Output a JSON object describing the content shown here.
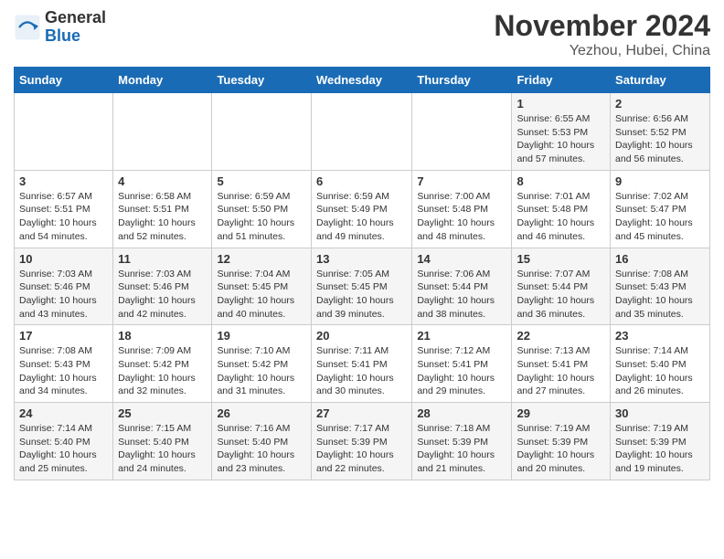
{
  "header": {
    "logo_line1": "General",
    "logo_line2": "Blue",
    "title": "November 2024",
    "subtitle": "Yezhou, Hubei, China"
  },
  "weekdays": [
    "Sunday",
    "Monday",
    "Tuesday",
    "Wednesday",
    "Thursday",
    "Friday",
    "Saturday"
  ],
  "weeks": [
    [
      {
        "day": "",
        "info": ""
      },
      {
        "day": "",
        "info": ""
      },
      {
        "day": "",
        "info": ""
      },
      {
        "day": "",
        "info": ""
      },
      {
        "day": "",
        "info": ""
      },
      {
        "day": "1",
        "info": "Sunrise: 6:55 AM\nSunset: 5:53 PM\nDaylight: 10 hours and 57 minutes."
      },
      {
        "day": "2",
        "info": "Sunrise: 6:56 AM\nSunset: 5:52 PM\nDaylight: 10 hours and 56 minutes."
      }
    ],
    [
      {
        "day": "3",
        "info": "Sunrise: 6:57 AM\nSunset: 5:51 PM\nDaylight: 10 hours and 54 minutes."
      },
      {
        "day": "4",
        "info": "Sunrise: 6:58 AM\nSunset: 5:51 PM\nDaylight: 10 hours and 52 minutes."
      },
      {
        "day": "5",
        "info": "Sunrise: 6:59 AM\nSunset: 5:50 PM\nDaylight: 10 hours and 51 minutes."
      },
      {
        "day": "6",
        "info": "Sunrise: 6:59 AM\nSunset: 5:49 PM\nDaylight: 10 hours and 49 minutes."
      },
      {
        "day": "7",
        "info": "Sunrise: 7:00 AM\nSunset: 5:48 PM\nDaylight: 10 hours and 48 minutes."
      },
      {
        "day": "8",
        "info": "Sunrise: 7:01 AM\nSunset: 5:48 PM\nDaylight: 10 hours and 46 minutes."
      },
      {
        "day": "9",
        "info": "Sunrise: 7:02 AM\nSunset: 5:47 PM\nDaylight: 10 hours and 45 minutes."
      }
    ],
    [
      {
        "day": "10",
        "info": "Sunrise: 7:03 AM\nSunset: 5:46 PM\nDaylight: 10 hours and 43 minutes."
      },
      {
        "day": "11",
        "info": "Sunrise: 7:03 AM\nSunset: 5:46 PM\nDaylight: 10 hours and 42 minutes."
      },
      {
        "day": "12",
        "info": "Sunrise: 7:04 AM\nSunset: 5:45 PM\nDaylight: 10 hours and 40 minutes."
      },
      {
        "day": "13",
        "info": "Sunrise: 7:05 AM\nSunset: 5:45 PM\nDaylight: 10 hours and 39 minutes."
      },
      {
        "day": "14",
        "info": "Sunrise: 7:06 AM\nSunset: 5:44 PM\nDaylight: 10 hours and 38 minutes."
      },
      {
        "day": "15",
        "info": "Sunrise: 7:07 AM\nSunset: 5:44 PM\nDaylight: 10 hours and 36 minutes."
      },
      {
        "day": "16",
        "info": "Sunrise: 7:08 AM\nSunset: 5:43 PM\nDaylight: 10 hours and 35 minutes."
      }
    ],
    [
      {
        "day": "17",
        "info": "Sunrise: 7:08 AM\nSunset: 5:43 PM\nDaylight: 10 hours and 34 minutes."
      },
      {
        "day": "18",
        "info": "Sunrise: 7:09 AM\nSunset: 5:42 PM\nDaylight: 10 hours and 32 minutes."
      },
      {
        "day": "19",
        "info": "Sunrise: 7:10 AM\nSunset: 5:42 PM\nDaylight: 10 hours and 31 minutes."
      },
      {
        "day": "20",
        "info": "Sunrise: 7:11 AM\nSunset: 5:41 PM\nDaylight: 10 hours and 30 minutes."
      },
      {
        "day": "21",
        "info": "Sunrise: 7:12 AM\nSunset: 5:41 PM\nDaylight: 10 hours and 29 minutes."
      },
      {
        "day": "22",
        "info": "Sunrise: 7:13 AM\nSunset: 5:41 PM\nDaylight: 10 hours and 27 minutes."
      },
      {
        "day": "23",
        "info": "Sunrise: 7:14 AM\nSunset: 5:40 PM\nDaylight: 10 hours and 26 minutes."
      }
    ],
    [
      {
        "day": "24",
        "info": "Sunrise: 7:14 AM\nSunset: 5:40 PM\nDaylight: 10 hours and 25 minutes."
      },
      {
        "day": "25",
        "info": "Sunrise: 7:15 AM\nSunset: 5:40 PM\nDaylight: 10 hours and 24 minutes."
      },
      {
        "day": "26",
        "info": "Sunrise: 7:16 AM\nSunset: 5:40 PM\nDaylight: 10 hours and 23 minutes."
      },
      {
        "day": "27",
        "info": "Sunrise: 7:17 AM\nSunset: 5:39 PM\nDaylight: 10 hours and 22 minutes."
      },
      {
        "day": "28",
        "info": "Sunrise: 7:18 AM\nSunset: 5:39 PM\nDaylight: 10 hours and 21 minutes."
      },
      {
        "day": "29",
        "info": "Sunrise: 7:19 AM\nSunset: 5:39 PM\nDaylight: 10 hours and 20 minutes."
      },
      {
        "day": "30",
        "info": "Sunrise: 7:19 AM\nSunset: 5:39 PM\nDaylight: 10 hours and 19 minutes."
      }
    ]
  ]
}
